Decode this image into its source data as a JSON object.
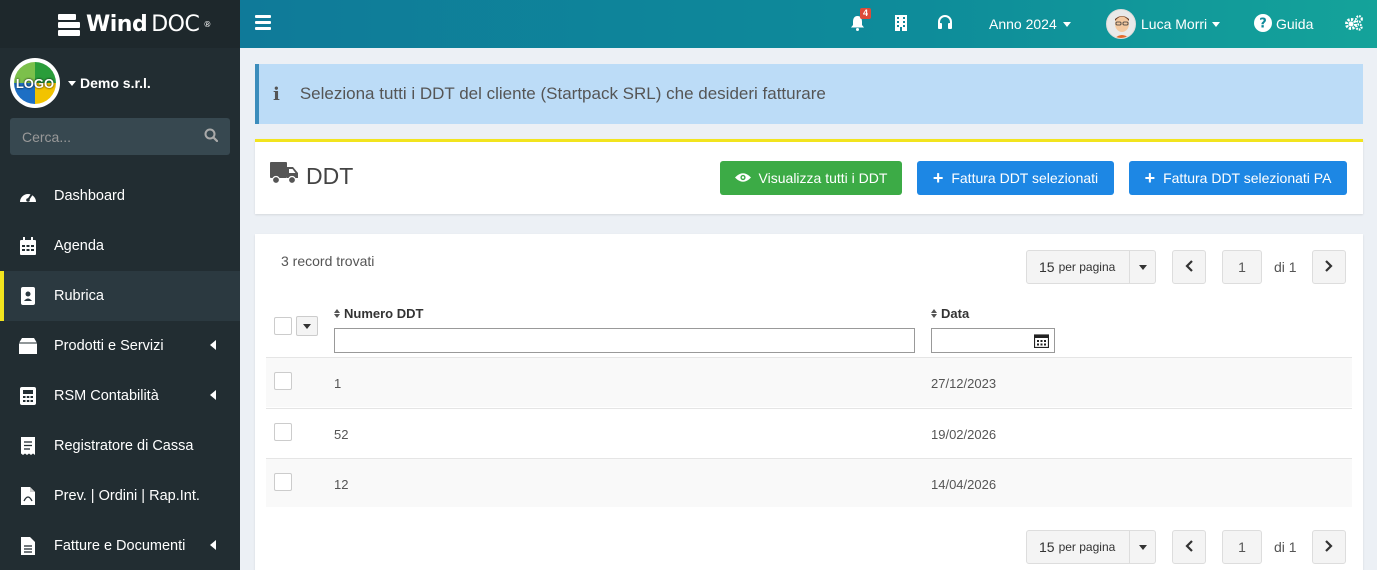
{
  "brand": {
    "name_bold": "Wind",
    "name_light": "DOC",
    "reg": "®"
  },
  "company": {
    "logo_text": "LOGO",
    "name": "Demo s.r.l."
  },
  "search": {
    "placeholder": "Cerca..."
  },
  "sidebar": {
    "items": [
      {
        "label": "Dashboard",
        "icon": "gauge-icon",
        "has_submenu": false,
        "active": false
      },
      {
        "label": "Agenda",
        "icon": "calendar-icon",
        "has_submenu": false,
        "active": false
      },
      {
        "label": "Rubrica",
        "icon": "address-book-icon",
        "has_submenu": false,
        "active": true
      },
      {
        "label": "Prodotti e Servizi",
        "icon": "box-icon",
        "has_submenu": true,
        "active": false
      },
      {
        "label": "RSM Contabilità",
        "icon": "calculator-icon",
        "has_submenu": true,
        "active": false
      },
      {
        "label": "Registratore di Cassa",
        "icon": "receipt-icon",
        "has_submenu": false,
        "active": false
      },
      {
        "label": "Prev. | Ordini | Rap.Int.",
        "icon": "pdf-file-icon",
        "has_submenu": false,
        "active": false
      },
      {
        "label": "Fatture e Documenti",
        "icon": "file-icon",
        "has_submenu": true,
        "active": false
      }
    ]
  },
  "topbar": {
    "notifications_count": "4",
    "year_label": "Anno 2024",
    "user_name": "Luca Morri",
    "help_label": "Guida"
  },
  "alert": {
    "text": "Seleziona tutti i DDT del cliente (Startpack SRL) che desideri fatturare"
  },
  "ddt_box": {
    "title": "DDT",
    "btn_view_all": "Visualizza tutti i DDT",
    "btn_invoice": "Fattura DDT selezionati",
    "btn_invoice_pa": "Fattura DDT selezionati PA"
  },
  "list": {
    "records_found": "3 record trovati",
    "per_page_value": "15",
    "per_page_suffix": "per pagina",
    "current_page": "1",
    "page_of": "di 1",
    "columns": {
      "number": "Numero DDT",
      "date": "Data"
    },
    "rows": [
      {
        "number": "1",
        "date": "27/12/2023"
      },
      {
        "number": "52",
        "date": "19/02/2026"
      },
      {
        "number": "12",
        "date": "14/04/2026"
      }
    ]
  },
  "colors": {
    "sidebar_bg": "#222d32",
    "accent_yellow": "#f2e41e",
    "btn_green": "#3cab46",
    "btn_blue": "#1d87e4",
    "alert_bg": "#bcdcf7"
  }
}
